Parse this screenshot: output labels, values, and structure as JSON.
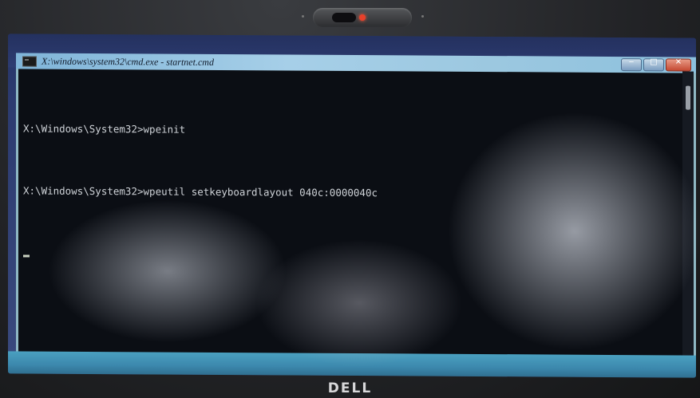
{
  "bezel": {
    "brand_logo": "DELL",
    "webcam_led_color": "#e8402a"
  },
  "window": {
    "title": "X:\\windows\\system32\\cmd.exe - startnet.cmd",
    "controls": {
      "minimize_icon": "minimize-icon",
      "maximize_icon": "maximize-icon",
      "close_icon": "close-icon"
    }
  },
  "console": {
    "lines": [
      "X:\\Windows\\System32>wpeinit",
      "X:\\Windows\\System32>wpeutil setkeyboardlayout 040c:0000040c"
    ]
  },
  "colors": {
    "console_background": "#0b0e14",
    "console_text": "#cfd3d8",
    "titlebar": "#a6cfe8",
    "desktop": "#2c3b70"
  }
}
